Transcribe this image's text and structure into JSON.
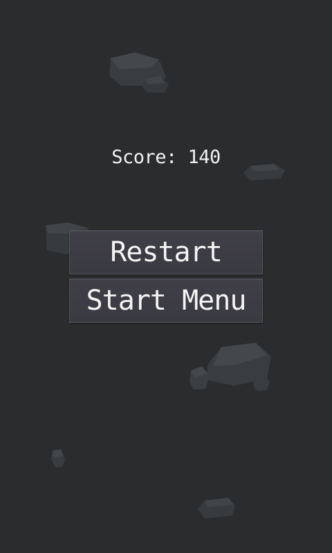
{
  "hud": {
    "score_text": "Score: 140"
  },
  "menu": {
    "restart_label": "Restart",
    "start_menu_label": "Start Menu"
  },
  "colors": {
    "background": "#2b2c2e",
    "button_fill": "#3d3c44",
    "text": "#f2f2f2"
  },
  "background_objects": [
    "rock",
    "rock",
    "rock",
    "rock",
    "rock",
    "rock",
    "rock",
    "rock"
  ]
}
